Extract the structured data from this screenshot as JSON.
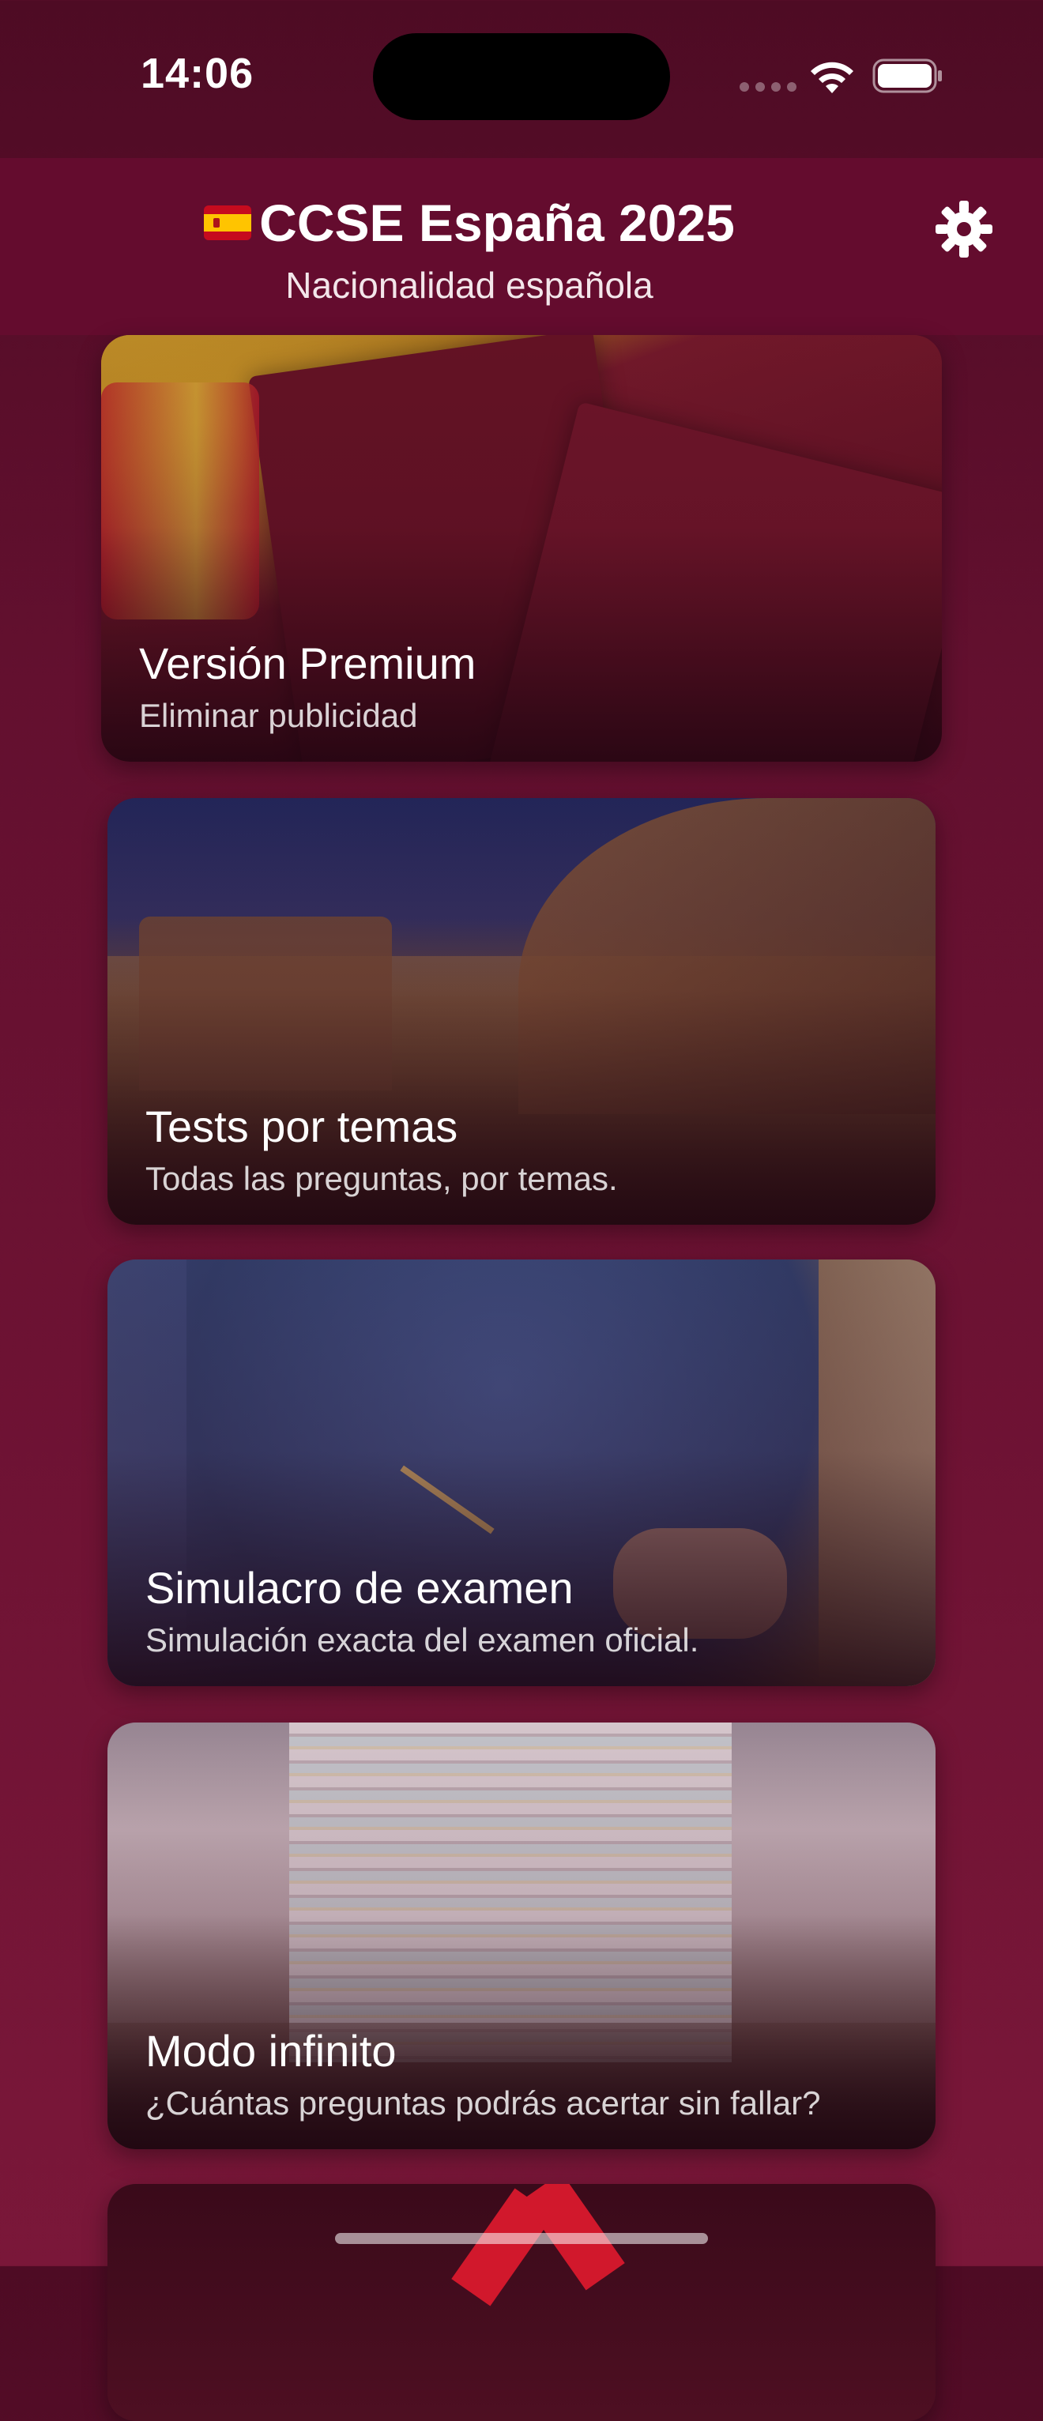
{
  "status_bar": {
    "time": "14:06"
  },
  "header": {
    "flag": "🇪🇸",
    "title": "CCSE España 2025",
    "subtitle": "Nacionalidad española",
    "settings_icon": "gear-icon"
  },
  "cards": [
    {
      "title": "Versión Premium",
      "subtitle": "Eliminar publicidad"
    },
    {
      "title": "Tests por temas",
      "subtitle": "Todas las preguntas, por temas."
    },
    {
      "title": "Simulacro de examen",
      "subtitle": "Simulación exacta del examen oficial."
    },
    {
      "title": "Modo infinito",
      "subtitle": "¿Cuántas preguntas podrás acertar sin fallar?"
    }
  ],
  "colors": {
    "header_background": "#640c2e",
    "page_background": "#6d1233"
  }
}
